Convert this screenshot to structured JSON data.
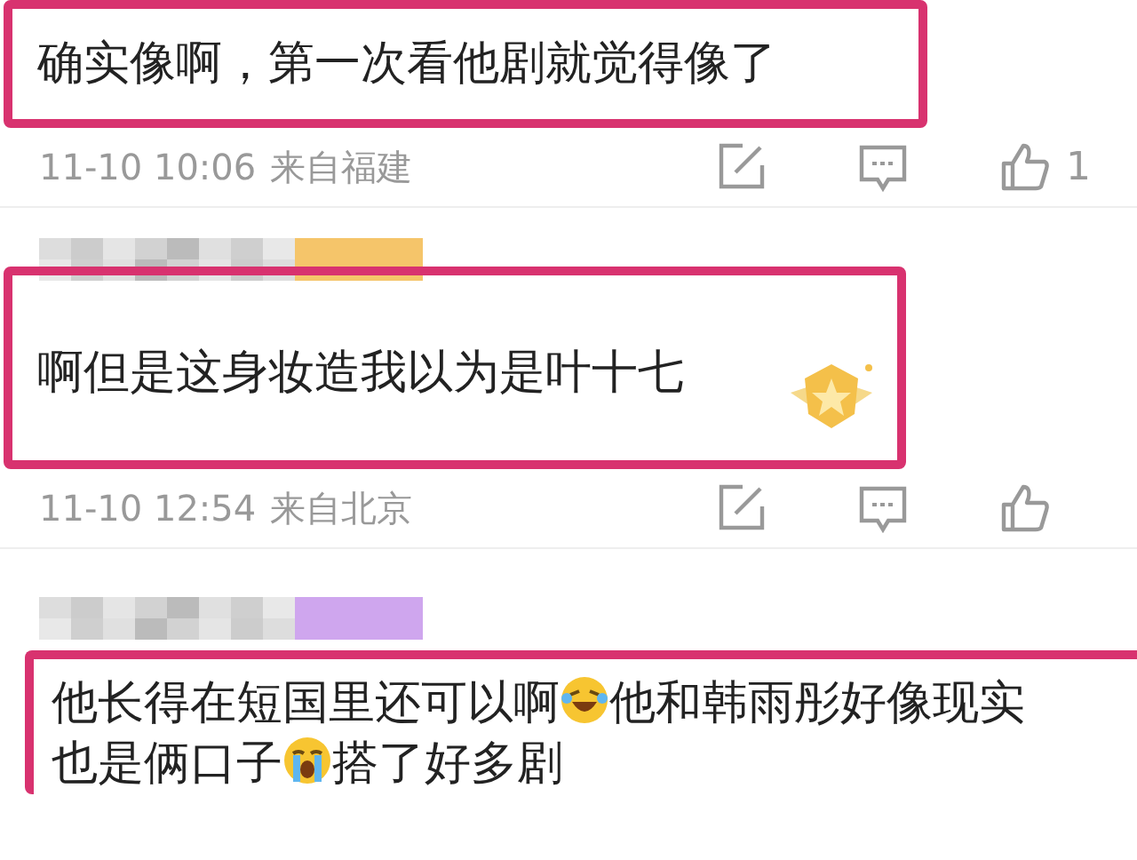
{
  "comments": [
    {
      "kind": "cut-off",
      "badge": false,
      "parts": [
        {
          "kind": "text",
          "text": "确实像啊，第一次看他剧就觉得像了"
        }
      ],
      "time": "11-10 10:06",
      "location": "来自福建",
      "likes": "1"
    },
    {
      "kind": "blurred-name",
      "color": "#f5c56a",
      "badge": true,
      "parts": [
        {
          "kind": "text",
          "text": "啊但是这身妆造我以为是叶十七"
        }
      ],
      "time": "11-10 12:54",
      "location": "来自北京"
    },
    {
      "kind": "blurred-name",
      "color": "#cfa6ee",
      "badge": false,
      "parts": [
        {
          "kind": "text",
          "text": "他长得在短国里还可以啊"
        },
        {
          "kind": "laugh-emoji"
        },
        {
          "kind": "text",
          "text": "他和韩雨彤好像现实也是俩口子"
        },
        {
          "kind": "cry-emoji"
        },
        {
          "kind": "text",
          "text": "搭了好多剧"
        }
      ]
    }
  ]
}
